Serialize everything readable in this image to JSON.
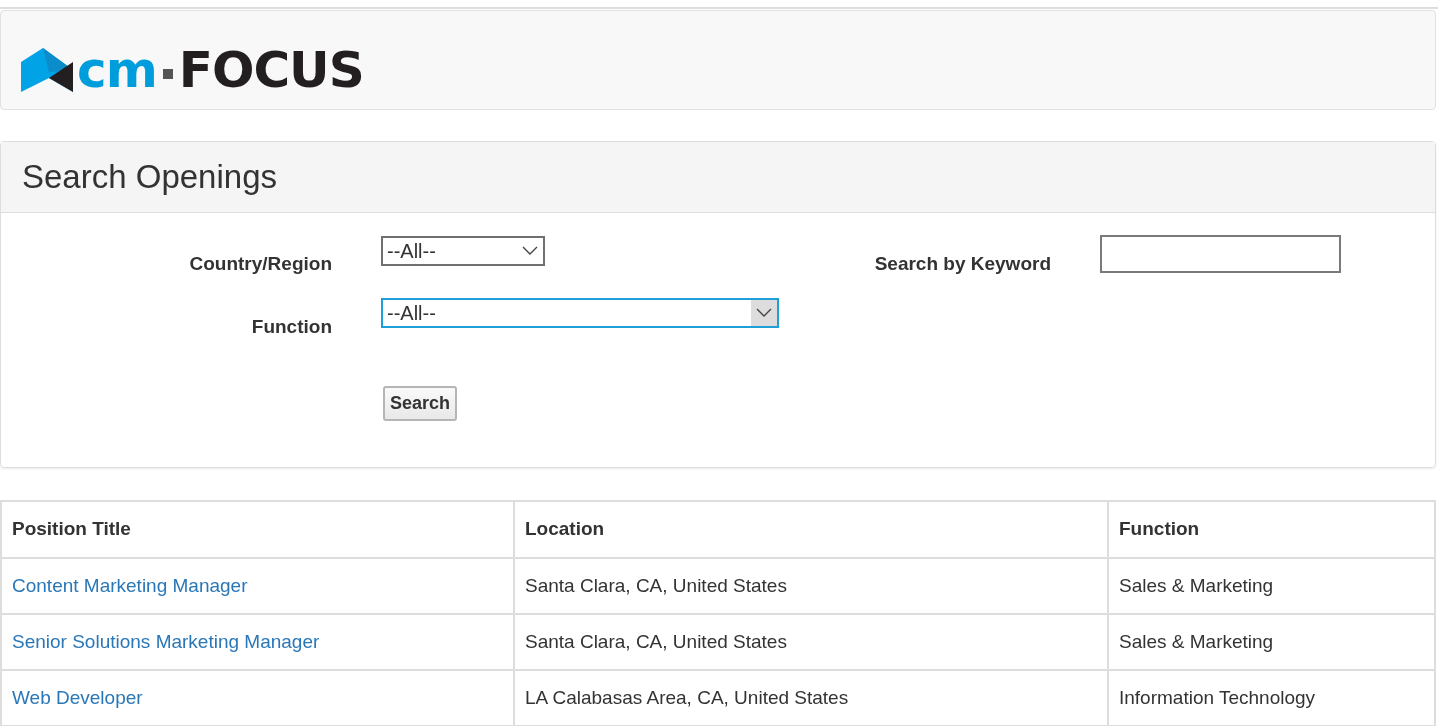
{
  "logo": {
    "prefix": "cm",
    "suffix": "FOCUS"
  },
  "search_panel": {
    "title": "Search Openings",
    "fields": [
      {
        "label": "Country/Region",
        "kind": "select",
        "value": "--All--",
        "focused": false
      },
      {
        "label": "Search by Keyword",
        "kind": "text",
        "focused": false
      },
      {
        "label": "Function",
        "kind": "select",
        "value": "--All--",
        "focused": true
      }
    ],
    "search_button": "Search"
  },
  "table": {
    "columns": [
      "Position Title",
      "Location",
      "Function"
    ],
    "rows": [
      {
        "title": "Content Marketing Manager",
        "location": "Santa Clara, CA, United States",
        "function": "Sales & Marketing"
      },
      {
        "title": "Senior Solutions Marketing Manager",
        "location": "Santa Clara, CA, United States",
        "function": "Sales & Marketing"
      },
      {
        "title": "Web Developer",
        "location": "LA Calabasas Area, CA, United States",
        "function": "Information Technology"
      }
    ]
  }
}
